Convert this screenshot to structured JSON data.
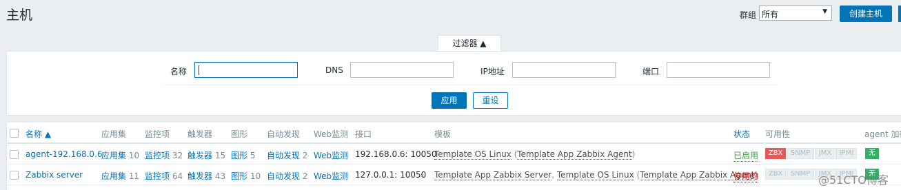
{
  "page": {
    "title": "主机",
    "group_label": "群组",
    "group_value": "所有",
    "create_button": "创建主机"
  },
  "filter": {
    "tab_label": "过滤器 ▲",
    "name_label": "名称",
    "dns_label": "DNS",
    "ip_label": "IP地址",
    "port_label": "端口",
    "apply_label": "应用",
    "reset_label": "重设"
  },
  "table": {
    "headers": {
      "name": "名称 ▲",
      "apps": "应用集",
      "items": "监控项",
      "triggers": "触发器",
      "graphs": "图形",
      "discovery": "自动发现",
      "web": "Web监测",
      "interface": "接口",
      "templates": "模板",
      "status": "状态",
      "availability": "可用性",
      "agent_enc": "agent 加密"
    },
    "rows": [
      {
        "name": "agent-192.168.0.6",
        "apps_label": "应用集",
        "apps_count": "10",
        "items_label": "监控项",
        "items_count": "32",
        "triggers_label": "触发器",
        "triggers_count": "15",
        "graphs_label": "图形",
        "graphs_count": "5",
        "discovery_label": "自动发现",
        "discovery_count": "2",
        "web_label": "Web监测",
        "interface": "192.168.0.6: 10050",
        "tpl1": "Template OS Linux",
        "tpl_paren_open": " (",
        "tpl2": "Template App Zabbix Agent",
        "tpl_paren_close": ")",
        "status": "已启用",
        "zbx": "ZBX",
        "snmp": "SNMP",
        "jmx": "JMX",
        "ipmi": "IPMI",
        "enc": "无"
      },
      {
        "name": "Zabbix server",
        "apps_label": "应用集",
        "apps_count": "11",
        "items_label": "监控项",
        "items_count": "64",
        "triggers_label": "触发器",
        "triggers_count": "43",
        "graphs_label": "图形",
        "graphs_count": "10",
        "discovery_label": "自动发现",
        "discovery_count": "2",
        "web_label": "Web监测",
        "interface": "127.0.0.1: 10050",
        "tpl1": "Template App Zabbix Server",
        "tpl_sep": ", ",
        "tpl2": "Template OS Linux",
        "tpl_paren_open": " (",
        "tpl3": "Template App Zabbix Agent",
        "tpl_paren_close": ")",
        "status": "停用的",
        "zbx": "ZBX",
        "snmp": "SNMP",
        "jmx": "JMX",
        "ipmi": "IPMI",
        "enc": "无"
      }
    ]
  },
  "watermark": "@51CTO博客",
  "colors": {
    "accent": "#0275b8",
    "enabled": "#429e47",
    "disabled": "#d40000",
    "zbx_unavailable": "#e45959",
    "enc_none": "#34af67"
  }
}
